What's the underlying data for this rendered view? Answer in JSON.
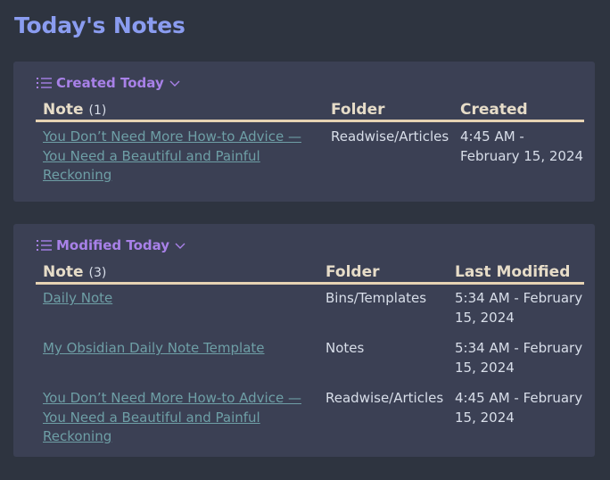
{
  "page": {
    "title": "Today's Notes"
  },
  "colors": {
    "background": "#2e3440",
    "card": "#3b4054",
    "title": "#8a9cf0",
    "section_header": "#a881e8",
    "link": "#6e9fa6",
    "header_text": "#e6dcc8",
    "header_rule": "#e6d3b3"
  },
  "created_today": {
    "header": "Created Today",
    "icons": [
      "list-icon",
      "chevron-down-icon"
    ],
    "columns": {
      "note": "Note",
      "note_count": "(1)",
      "folder": "Folder",
      "date": "Created"
    },
    "rows": [
      {
        "note": "You Don’t Need More How-to Advice — You Need a Beautiful and Painful Reckoning",
        "folder": "Readwise/Articles",
        "date": "4:45 AM - February 15, 2024"
      }
    ]
  },
  "modified_today": {
    "header": "Modified Today",
    "icons": [
      "list-icon",
      "chevron-down-icon"
    ],
    "columns": {
      "note": "Note",
      "note_count": "(3)",
      "folder": "Folder",
      "date": "Last Modified"
    },
    "rows": [
      {
        "note": "Daily Note",
        "folder": "Bins/Templates",
        "date": "5:34 AM - February 15, 2024"
      },
      {
        "note": "My Obsidian Daily Note Template",
        "folder": "Notes",
        "date": "5:34 AM - February 15, 2024"
      },
      {
        "note": "You Don’t Need More How-to Advice — You Need a Beautiful and Painful Reckoning",
        "folder": "Readwise/Articles",
        "date": "4:45 AM - February 15, 2024"
      }
    ]
  }
}
